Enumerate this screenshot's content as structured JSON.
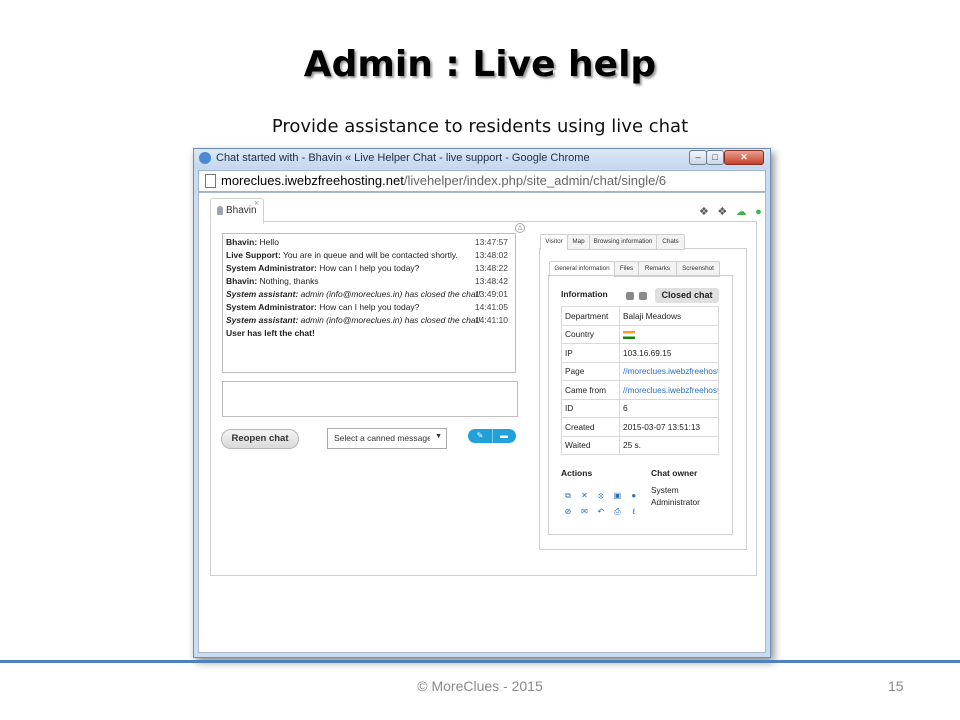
{
  "slide": {
    "title": "Admin : Live help",
    "subtitle": "Provide assistance to residents using live chat",
    "footer": "© MoreClues - 2015",
    "page_number": "15",
    "accent_color": "#4f81bd"
  },
  "browser": {
    "title": "Chat started with - Bhavin « Live Helper Chat - live support - Google Chrome",
    "url_host": "moreclues.iwebzfreehosting.net",
    "url_path": "/livehelper/index.php/site_admin/chat/single/6",
    "controls": {
      "minimize": "–",
      "maximize": "□",
      "close": "✕"
    }
  },
  "chat_tab": {
    "user": "Bhavin",
    "close_glyph": "×"
  },
  "top_icons": [
    "chat-bubbles-icon",
    "chat-bubbles-icon",
    "cloud-icon",
    "user-icon"
  ],
  "messages": [
    {
      "author": "Bhavin:",
      "text": "Hello",
      "time": "13:47:57",
      "italic": false
    },
    {
      "author": "Live Support:",
      "text": "You are in queue and will be contacted shortly.",
      "time": "13:48:02",
      "italic": false
    },
    {
      "author": "System Administrator:",
      "text": "How can I help you today?",
      "time": "13:48:22",
      "italic": false
    },
    {
      "author": "Bhavin:",
      "text": "Nothing, thanks",
      "time": "13:48:42",
      "italic": false
    },
    {
      "author": "System assistant:",
      "text": "admin (info@moreclues.in) has closed the chat!",
      "time": "13:49:01",
      "italic": true
    },
    {
      "author": "System Administrator:",
      "text": "How can I help you today?",
      "time": "14:41:05",
      "italic": false
    },
    {
      "author": "System assistant:",
      "text": "admin (info@moreclues.in) has closed the chat!",
      "time": "14:41:10",
      "italic": true
    }
  ],
  "left_chat_notice": "User has left the chat!",
  "controls": {
    "reopen_label": "Reopen chat",
    "canned_placeholder": "Select a canned message",
    "dropdown_arrow": "▼"
  },
  "right_tabs": [
    "Visitor",
    "Map",
    "Browsing information",
    "Chats"
  ],
  "sub_tabs": [
    "General information",
    "Files",
    "Remarks",
    "Screenshot"
  ],
  "info": {
    "heading": "Information",
    "status_badge": "Closed chat",
    "rows": [
      {
        "key": "Department",
        "value": "Balaji Meadows"
      },
      {
        "key": "Country",
        "value": "",
        "flag": "india-flag-icon"
      },
      {
        "key": "IP",
        "value": "103.16.69.15"
      },
      {
        "key": "Page",
        "value": "//moreclues.iwebzfreehosting.net",
        "link": true
      },
      {
        "key": "Came from",
        "value": "//moreclues.iwebzfreehosting.net",
        "link": true
      },
      {
        "key": "ID",
        "value": "6"
      },
      {
        "key": "Created",
        "value": "2015-03-07 13:51:13"
      },
      {
        "key": "Waited",
        "value": "25 s."
      }
    ]
  },
  "actions": {
    "heading": "Actions",
    "row1": [
      "external-window-icon",
      "close-x-icon",
      "remove-circle-icon",
      "trash-box-icon",
      "users-icon"
    ],
    "row2": [
      "block-icon",
      "mail-icon",
      "reply-icon",
      "print-icon",
      "attachment-icon"
    ]
  },
  "owner": {
    "heading": "Chat owner",
    "name": "System Administrator"
  }
}
